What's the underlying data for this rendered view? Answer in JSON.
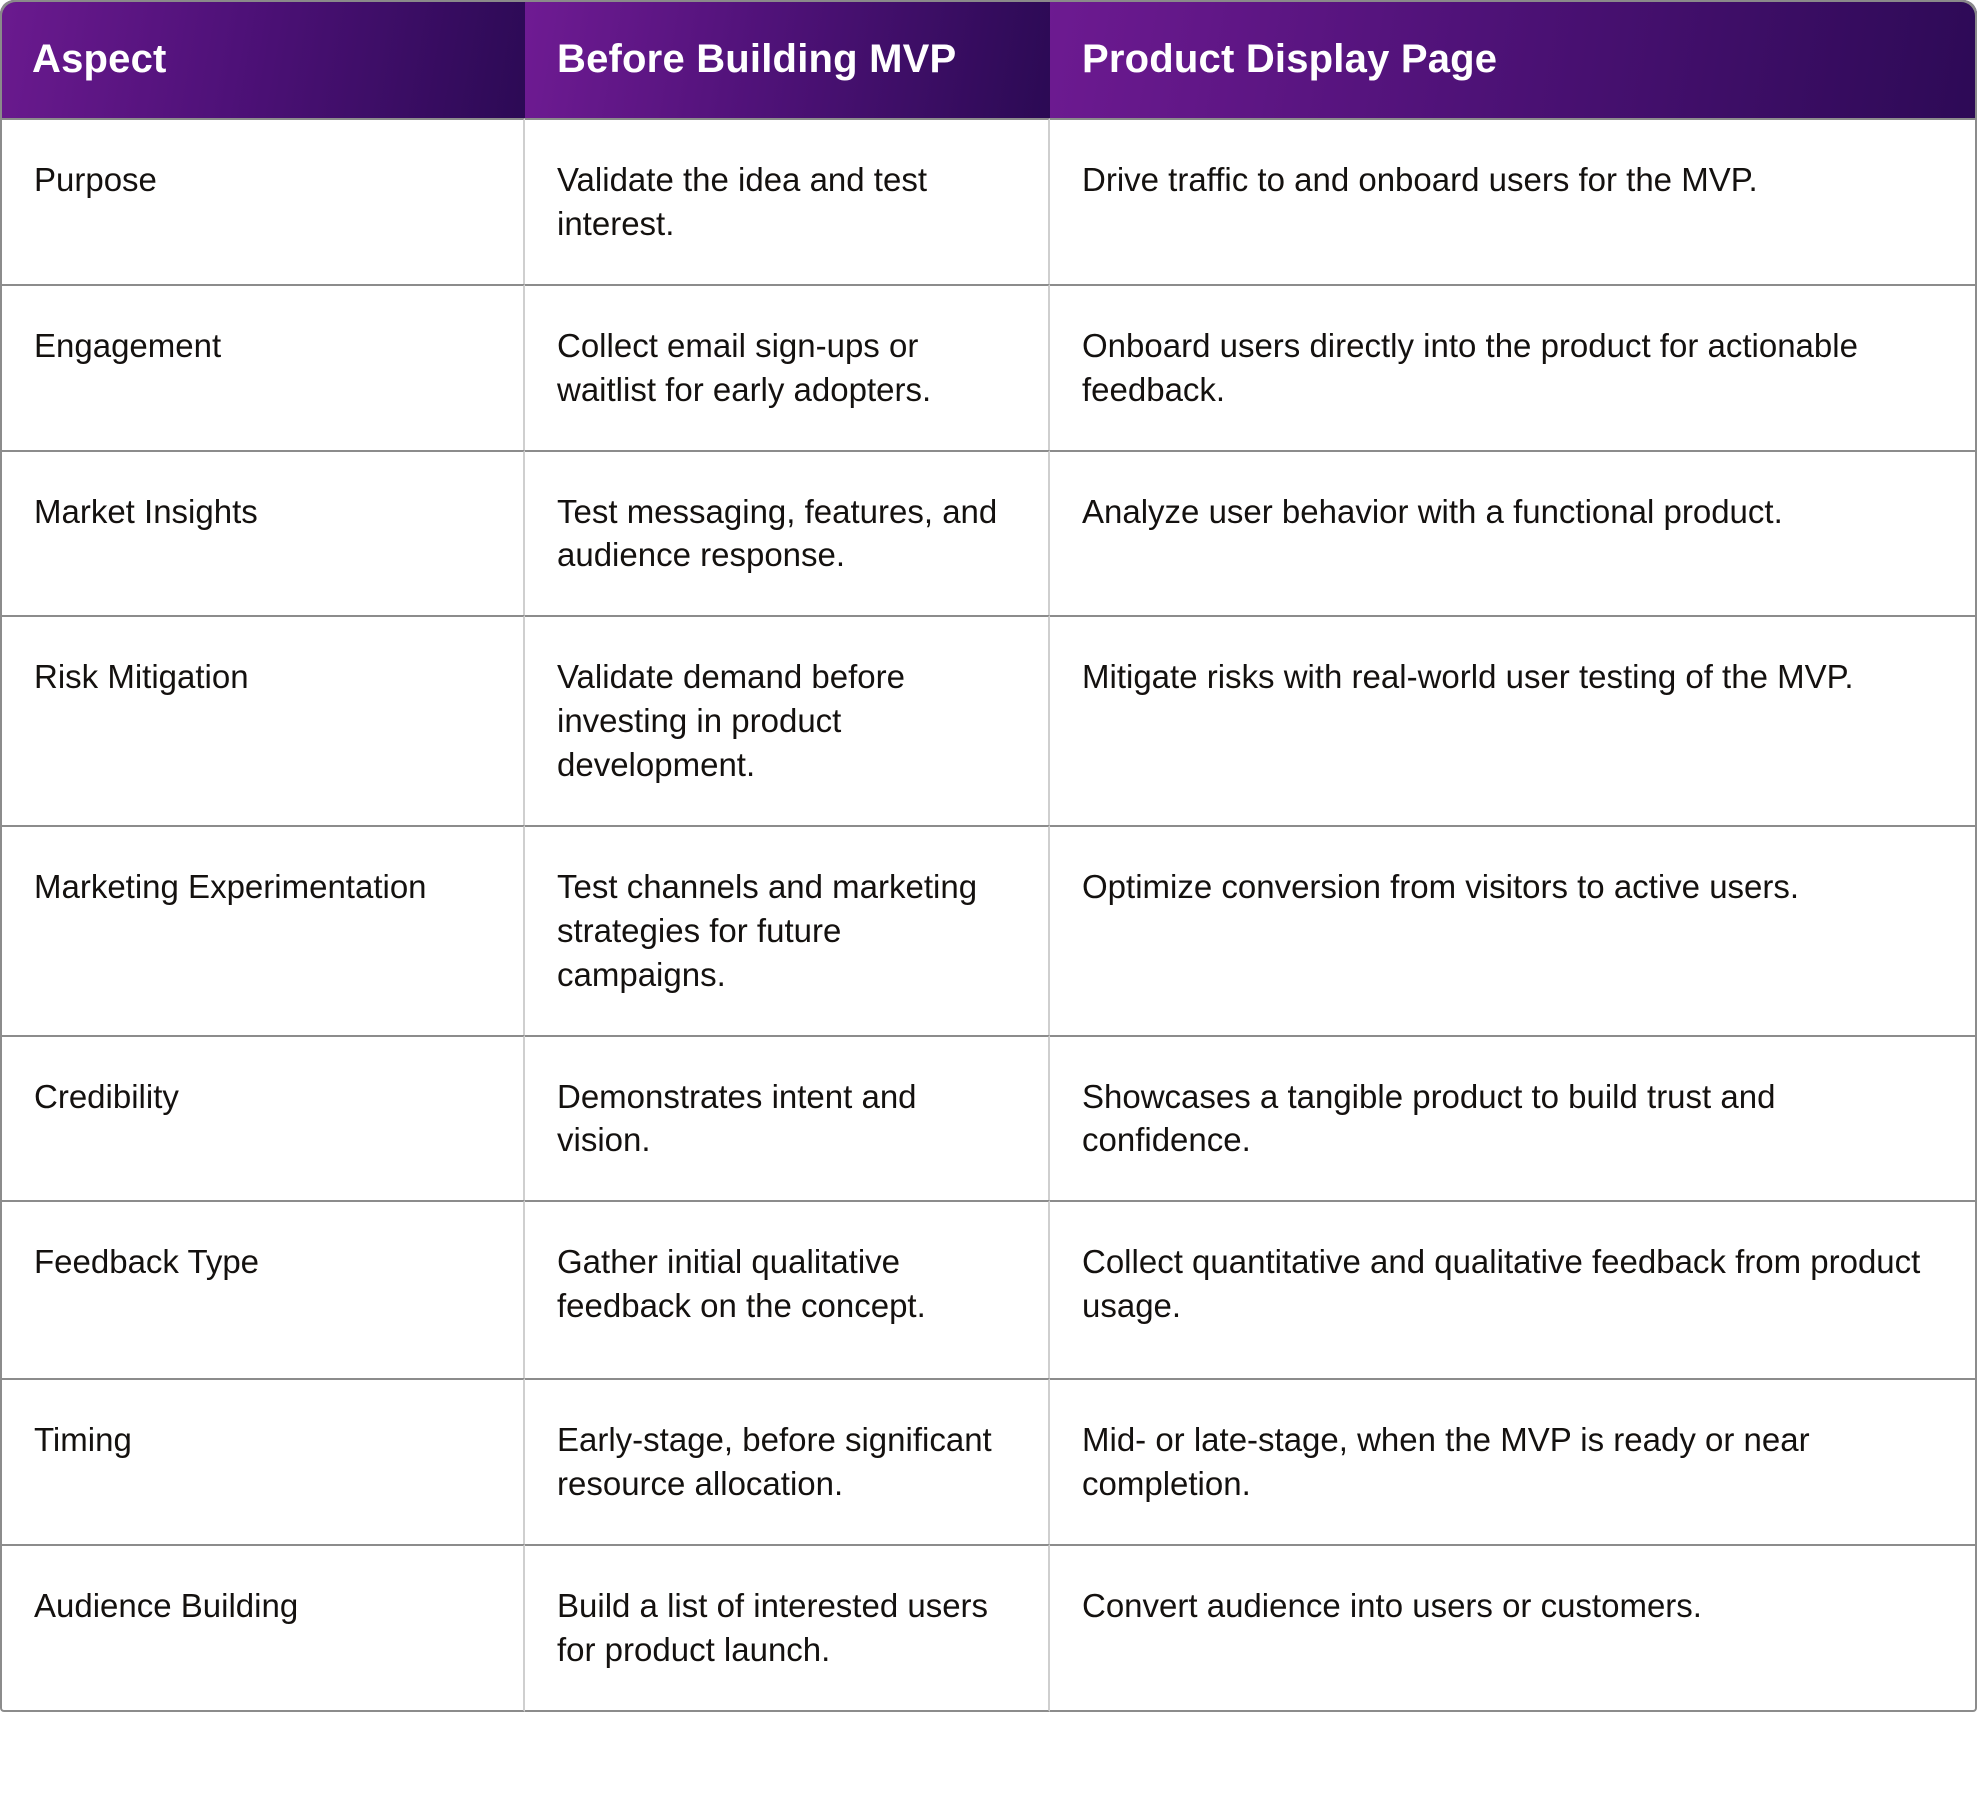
{
  "table": {
    "columns": [
      {
        "key": "aspect",
        "label": "Aspect"
      },
      {
        "key": "before",
        "label": "Before Building MVP"
      },
      {
        "key": "pdp",
        "label": "Product Display Page"
      }
    ],
    "header_gradient": {
      "from": "#6b1a8f",
      "mid": "#4e1178",
      "to": "#2c0a55"
    },
    "colors": {
      "header_text": "#ffffff",
      "body_text": "#14110f",
      "body_background": "#ffffff",
      "outer_border": "#8c8c8c",
      "inner_border": "#cfcfcf"
    },
    "rows": [
      {
        "aspect": "Purpose",
        "before": "Validate the idea and test interest.",
        "pdp": "Drive traffic to and onboard users for the MVP."
      },
      {
        "aspect": "Engagement",
        "before": "Collect email sign-ups or waitlist for early adopters.",
        "pdp": "Onboard users directly into the product for actionable feedback."
      },
      {
        "aspect": "Market Insights",
        "before": "Test messaging, features, and audience response.",
        "pdp": "Analyze user behavior with a functional product."
      },
      {
        "aspect": "Risk Mitigation",
        "before": "Validate demand before investing in product development.",
        "pdp": "Mitigate risks with real-world user testing of the MVP."
      },
      {
        "aspect": "Marketing Experimentation",
        "before": "Test channels and marketing strategies for future campaigns.",
        "pdp": "Optimize conversion from visitors to active users."
      },
      {
        "aspect": "Credibility",
        "before": "Demonstrates intent and vision.",
        "pdp": "Showcases a tangible product to build trust and confidence."
      },
      {
        "aspect": "Feedback Type",
        "before": "Gather initial qualitative feedback on the concept.",
        "pdp": "Collect quantitative and qualitative feedback from product usage."
      },
      {
        "aspect": "Timing",
        "before": "Early-stage, before significant resource allocation.",
        "pdp": "Mid- or late-stage, when the MVP is ready or near completion."
      },
      {
        "aspect": "Audience Building",
        "before": "Build a list of interested users for product launch.",
        "pdp": "Convert audience into users or customers."
      }
    ]
  }
}
